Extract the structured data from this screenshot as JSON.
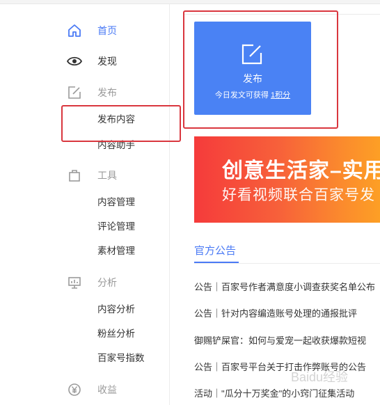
{
  "sidebar": {
    "home": "首页",
    "discover": "发现",
    "publish": "发布",
    "publish_content": "发布内容",
    "content_assistant": "内容助手",
    "tools": "工具",
    "content_manage": "内容管理",
    "comment_manage": "评论管理",
    "material_manage": "素材管理",
    "analysis": "分析",
    "content_analysis": "内容分析",
    "fans_analysis": "粉丝分析",
    "bjh_index": "百家号指数",
    "income": "收益"
  },
  "publish_card": {
    "label": "发布",
    "sub_prefix": "今日发文可获得",
    "sub_points": "1积分"
  },
  "banner": {
    "title": "创意生活家–实用",
    "subtitle": "好看视频联合百家号发"
  },
  "notices": {
    "tab": "官方公告",
    "items": [
      "公告｜百家号作者满意度小调查获奖名单公布",
      "公告｜针对内容编造账号处理的通报批评",
      "御赐铲屎官：如何与爱宠一起收获爆款短视",
      "公告｜百家号平台关于打击作弊账号的公告",
      "活动｜\"瓜分十万奖金\"的小窍门征集活动"
    ]
  },
  "watermark": "Baidu经验",
  "colors": {
    "accent": "#4a7af5",
    "highlight": "#d9363e"
  }
}
